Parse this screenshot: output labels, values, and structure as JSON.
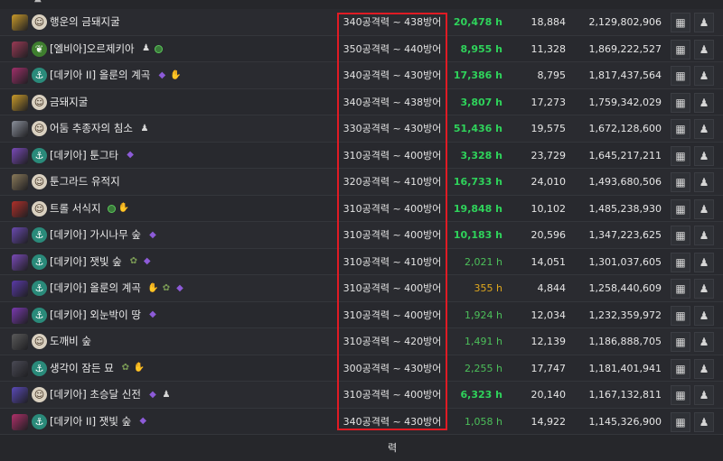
{
  "table": {
    "rows": [
      {
        "name": "행운의 금돼지굴",
        "range": "340공격력 ~ 438방어력",
        "hours": "20,478 h",
        "hours_style": "bright",
        "count": "18,884",
        "total": "2,129,802,906",
        "icon_color": "#c99a2a",
        "badge_color": "#d9d0c0",
        "badge_icon": "face-icon",
        "tags": []
      },
      {
        "name": "[엘비아]오르제키아",
        "range": "350공격력 ~ 440방어력",
        "hours": "8,955 h",
        "hours_style": "bright",
        "count": "11,328",
        "total": "1,869,222,527",
        "icon_color": "#9a3a55",
        "badge_color": "#3f7f2f",
        "badge_icon": "leaf-icon",
        "tags": [
          "cone",
          "dot"
        ]
      },
      {
        "name": "[데키아 II] 올룬의 계곡",
        "range": "340공격력 ~ 430방어력",
        "hours": "17,386 h",
        "hours_style": "bright",
        "count": "8,795",
        "total": "1,817,437,564",
        "icon_color": "#a0306a",
        "badge_color": "#2a8a7a",
        "badge_icon": "anchor-icon",
        "tags": [
          "gem",
          "claw"
        ]
      },
      {
        "name": "금돼지굴",
        "range": "340공격력 ~ 438방어력",
        "hours": "3,807 h",
        "hours_style": "bright",
        "count": "17,273",
        "total": "1,759,342,029",
        "icon_color": "#c99a2a",
        "badge_color": "#d9d0c0",
        "badge_icon": "face-icon",
        "tags": []
      },
      {
        "name": "어둠 추종자의 침소",
        "range": "330공격력 ~ 430방어력",
        "hours": "51,436 h",
        "hours_style": "bright",
        "count": "19,575",
        "total": "1,672,128,600",
        "icon_color": "#8a8f9a",
        "badge_color": "#d9d0c0",
        "badge_icon": "face-icon",
        "tags": [
          "cone"
        ]
      },
      {
        "name": "[데키아] 툰그타",
        "range": "310공격력 ~ 400방어력",
        "hours": "3,328 h",
        "hours_style": "bright",
        "count": "23,729",
        "total": "1,645,217,211",
        "icon_color": "#7a4ab8",
        "badge_color": "#2a8a7a",
        "badge_icon": "anchor-icon",
        "tags": [
          "gem"
        ]
      },
      {
        "name": "툰그라드 유적지",
        "range": "320공격력 ~ 410방어력",
        "hours": "16,733 h",
        "hours_style": "bright",
        "count": "24,010",
        "total": "1,493,680,506",
        "icon_color": "#8a7a5a",
        "badge_color": "#d9d0c0",
        "badge_icon": "face-icon",
        "tags": []
      },
      {
        "name": "트롤 서식지",
        "range": "310공격력 ~ 400방어력",
        "hours": "19,848 h",
        "hours_style": "bright",
        "count": "10,102",
        "total": "1,485,238,930",
        "icon_color": "#b0302a",
        "badge_color": "#d9d0c0",
        "badge_icon": "face-icon",
        "tags": [
          "dot",
          "claw"
        ]
      },
      {
        "name": "[데키아] 가시나무 숲",
        "range": "310공격력 ~ 400방어력",
        "hours": "10,183 h",
        "hours_style": "bright",
        "count": "20,596",
        "total": "1,347,223,625",
        "icon_color": "#6a4ab0",
        "badge_color": "#2a8a7a",
        "badge_icon": "anchor-icon",
        "tags": [
          "gem"
        ]
      },
      {
        "name": "[데키아] 잿빛 숲",
        "range": "310공격력 ~ 410방어력",
        "hours": "2,021 h",
        "hours_style": "green",
        "count": "14,051",
        "total": "1,301,037,605",
        "icon_color": "#7a4ab8",
        "badge_color": "#2a8a7a",
        "badge_icon": "anchor-icon",
        "tags": [
          "bird",
          "gem"
        ]
      },
      {
        "name": "[데키아] 올룬의 계곡",
        "range": "310공격력 ~ 400방어력",
        "hours": "355 h",
        "hours_style": "orange",
        "count": "4,844",
        "total": "1,258,440,609",
        "icon_color": "#5a3aa8",
        "badge_color": "#2a8a7a",
        "badge_icon": "anchor-icon",
        "tags": [
          "claw",
          "bird",
          "gem"
        ]
      },
      {
        "name": "[데키아] 외눈박이 땅",
        "range": "310공격력 ~ 400방어력",
        "hours": "1,924 h",
        "hours_style": "green",
        "count": "12,034",
        "total": "1,232,359,972",
        "icon_color": "#7a3ab0",
        "badge_color": "#2a8a7a",
        "badge_icon": "anchor-icon",
        "tags": [
          "gem"
        ]
      },
      {
        "name": "도깨비 숲",
        "range": "310공격력 ~ 420방어력",
        "hours": "1,491 h",
        "hours_style": "green",
        "count": "12,139",
        "total": "1,186,888,705",
        "icon_color": "#5a5a5a",
        "badge_color": "#d9d0c0",
        "badge_icon": "face-icon",
        "tags": []
      },
      {
        "name": "생각이 잠든 묘",
        "range": "300공격력 ~ 430방어력",
        "hours": "2,255 h",
        "hours_style": "green",
        "count": "17,747",
        "total": "1,181,401,941",
        "icon_color": "#4a4a55",
        "badge_color": "#2a8a7a",
        "badge_icon": "anchor-icon",
        "tags": [
          "bird",
          "claw"
        ]
      },
      {
        "name": "[데키아] 초승달 신전",
        "range": "310공격력 ~ 400방어력",
        "hours": "6,323 h",
        "hours_style": "bright",
        "count": "20,140",
        "total": "1,167,132,811",
        "icon_color": "#5a4ab8",
        "badge_color": "#d9d0c0",
        "badge_icon": "face-icon",
        "tags": [
          "gem",
          "cone"
        ]
      },
      {
        "name": "[데키아 II] 잿빛 숲",
        "range": "340공격력 ~ 430방어력",
        "hours": "1,058 h",
        "hours_style": "green",
        "count": "14,922",
        "total": "1,145,326,900",
        "icon_color": "#b0306a",
        "badge_color": "#2a8a7a",
        "badge_icon": "anchor-icon",
        "tags": [
          "gem"
        ]
      }
    ]
  },
  "highlight_color": "#e01b24",
  "buttons": {
    "calendar_icon": "calendar-icon",
    "pawn_icon": "pawn-icon"
  }
}
